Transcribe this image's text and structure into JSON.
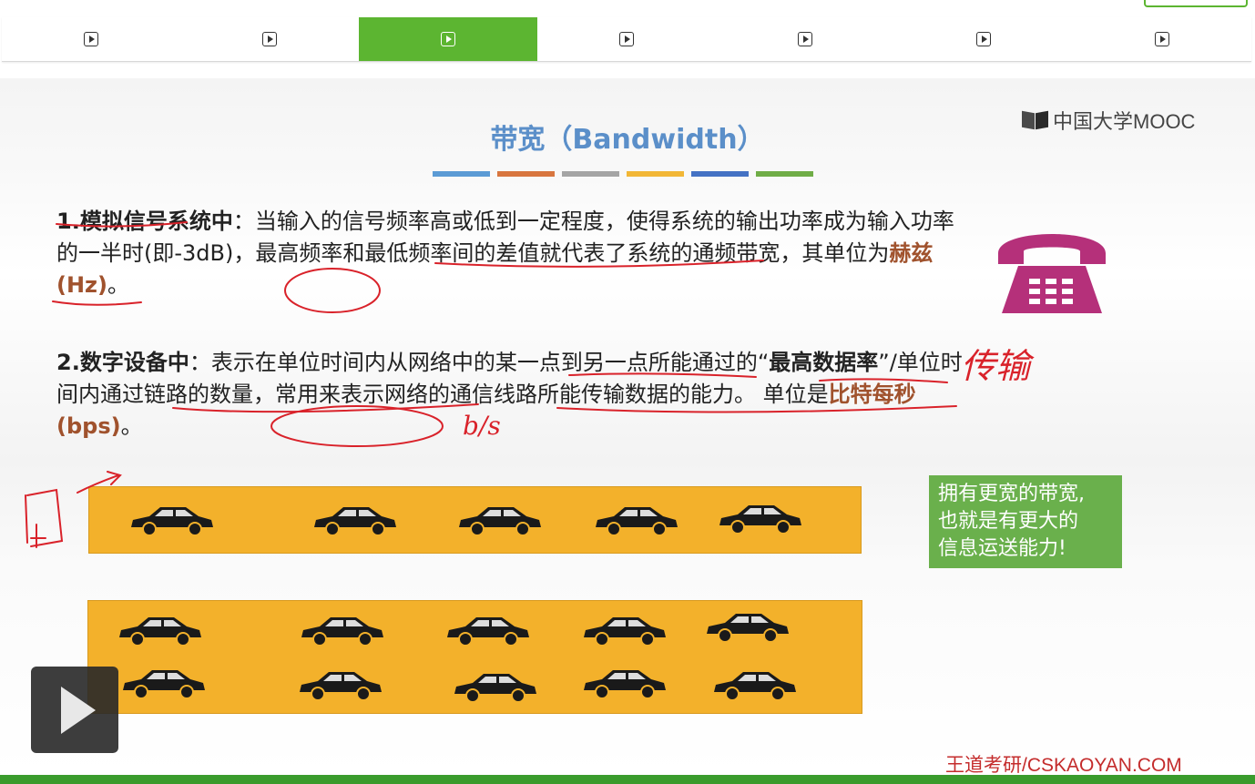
{
  "tabs": {
    "count": 7,
    "active_index": 2
  },
  "slide": {
    "title": "带宽（Bandwidth）",
    "logo_text": "中国大学MOOC",
    "color_bars": [
      "#5b9bd5",
      "#d8763f",
      "#a5a5a5",
      "#f2b736",
      "#4472c4",
      "#70ad47"
    ],
    "paragraph1": {
      "lead": "1.模拟信号系统中",
      "text1": "：当输入的信号频率高或低到一定程度，使得系统的输出功率成为输入功率的一半时(即-3dB)，最高频率和最低频率间的差值就代表了系统的通频带宽，其单位为",
      "highlight": "赫兹(Hz)",
      "text2": "。"
    },
    "paragraph2": {
      "lead": "2.数字设备中",
      "text1": "：表示在单位时间内从网络中的某一点到另一点所能通过的“",
      "lead2": "最高数据率",
      "text2": "”/单位时间内通过链路的数量，常用来表示网络的通信线路所能传输数据的能力。 单位是",
      "highlight": "比特每秒(bps)",
      "text3": "。"
    },
    "handwriting": {
      "note1": "传输",
      "note2": "b/s"
    },
    "note_box": {
      "line1": "拥有更宽的带宽,",
      "line2": "也就是有更大的",
      "line3": "信息运送能力!"
    },
    "watermark": "王道考研/CSKAOYAN.COM"
  },
  "colors": {
    "accent_green": "#5cb531",
    "title_blue": "#5b8fc9",
    "road": "#f3b12b",
    "note_green": "#6ab04c",
    "phone": "#b5307a",
    "ink_red": "#d9222a"
  }
}
